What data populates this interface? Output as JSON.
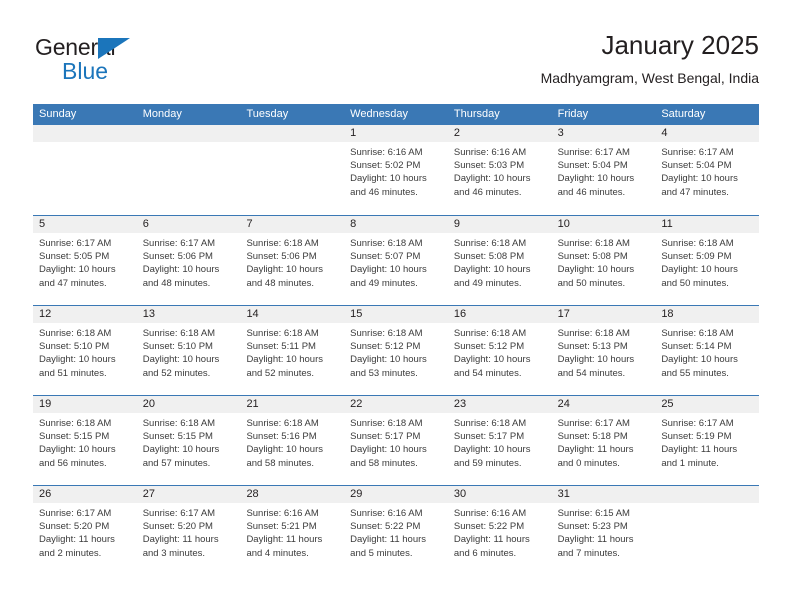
{
  "brand": {
    "word_one": "General",
    "word_two": "Blue",
    "accent_color": "#1b75bb",
    "triangle_icon": "brand-triangle-icon"
  },
  "header": {
    "title": "January 2025",
    "subtitle": "Madhyamgram, West Bengal, India"
  },
  "calendar": {
    "header_bg": "#3a78b5",
    "daynum_bg": "#f0f0f0",
    "weekdays": [
      "Sunday",
      "Monday",
      "Tuesday",
      "Wednesday",
      "Thursday",
      "Friday",
      "Saturday"
    ],
    "weeks": [
      [
        {
          "day": "",
          "empty": true
        },
        {
          "day": "",
          "empty": true
        },
        {
          "day": "",
          "empty": true
        },
        {
          "day": "1",
          "sunrise": "Sunrise: 6:16 AM",
          "sunset": "Sunset: 5:02 PM",
          "daylight": "Daylight: 10 hours and 46 minutes."
        },
        {
          "day": "2",
          "sunrise": "Sunrise: 6:16 AM",
          "sunset": "Sunset: 5:03 PM",
          "daylight": "Daylight: 10 hours and 46 minutes."
        },
        {
          "day": "3",
          "sunrise": "Sunrise: 6:17 AM",
          "sunset": "Sunset: 5:04 PM",
          "daylight": "Daylight: 10 hours and 46 minutes."
        },
        {
          "day": "4",
          "sunrise": "Sunrise: 6:17 AM",
          "sunset": "Sunset: 5:04 PM",
          "daylight": "Daylight: 10 hours and 47 minutes."
        }
      ],
      [
        {
          "day": "5",
          "sunrise": "Sunrise: 6:17 AM",
          "sunset": "Sunset: 5:05 PM",
          "daylight": "Daylight: 10 hours and 47 minutes."
        },
        {
          "day": "6",
          "sunrise": "Sunrise: 6:17 AM",
          "sunset": "Sunset: 5:06 PM",
          "daylight": "Daylight: 10 hours and 48 minutes."
        },
        {
          "day": "7",
          "sunrise": "Sunrise: 6:18 AM",
          "sunset": "Sunset: 5:06 PM",
          "daylight": "Daylight: 10 hours and 48 minutes."
        },
        {
          "day": "8",
          "sunrise": "Sunrise: 6:18 AM",
          "sunset": "Sunset: 5:07 PM",
          "daylight": "Daylight: 10 hours and 49 minutes."
        },
        {
          "day": "9",
          "sunrise": "Sunrise: 6:18 AM",
          "sunset": "Sunset: 5:08 PM",
          "daylight": "Daylight: 10 hours and 49 minutes."
        },
        {
          "day": "10",
          "sunrise": "Sunrise: 6:18 AM",
          "sunset": "Sunset: 5:08 PM",
          "daylight": "Daylight: 10 hours and 50 minutes."
        },
        {
          "day": "11",
          "sunrise": "Sunrise: 6:18 AM",
          "sunset": "Sunset: 5:09 PM",
          "daylight": "Daylight: 10 hours and 50 minutes."
        }
      ],
      [
        {
          "day": "12",
          "sunrise": "Sunrise: 6:18 AM",
          "sunset": "Sunset: 5:10 PM",
          "daylight": "Daylight: 10 hours and 51 minutes."
        },
        {
          "day": "13",
          "sunrise": "Sunrise: 6:18 AM",
          "sunset": "Sunset: 5:10 PM",
          "daylight": "Daylight: 10 hours and 52 minutes."
        },
        {
          "day": "14",
          "sunrise": "Sunrise: 6:18 AM",
          "sunset": "Sunset: 5:11 PM",
          "daylight": "Daylight: 10 hours and 52 minutes."
        },
        {
          "day": "15",
          "sunrise": "Sunrise: 6:18 AM",
          "sunset": "Sunset: 5:12 PM",
          "daylight": "Daylight: 10 hours and 53 minutes."
        },
        {
          "day": "16",
          "sunrise": "Sunrise: 6:18 AM",
          "sunset": "Sunset: 5:12 PM",
          "daylight": "Daylight: 10 hours and 54 minutes."
        },
        {
          "day": "17",
          "sunrise": "Sunrise: 6:18 AM",
          "sunset": "Sunset: 5:13 PM",
          "daylight": "Daylight: 10 hours and 54 minutes."
        },
        {
          "day": "18",
          "sunrise": "Sunrise: 6:18 AM",
          "sunset": "Sunset: 5:14 PM",
          "daylight": "Daylight: 10 hours and 55 minutes."
        }
      ],
      [
        {
          "day": "19",
          "sunrise": "Sunrise: 6:18 AM",
          "sunset": "Sunset: 5:15 PM",
          "daylight": "Daylight: 10 hours and 56 minutes."
        },
        {
          "day": "20",
          "sunrise": "Sunrise: 6:18 AM",
          "sunset": "Sunset: 5:15 PM",
          "daylight": "Daylight: 10 hours and 57 minutes."
        },
        {
          "day": "21",
          "sunrise": "Sunrise: 6:18 AM",
          "sunset": "Sunset: 5:16 PM",
          "daylight": "Daylight: 10 hours and 58 minutes."
        },
        {
          "day": "22",
          "sunrise": "Sunrise: 6:18 AM",
          "sunset": "Sunset: 5:17 PM",
          "daylight": "Daylight: 10 hours and 58 minutes."
        },
        {
          "day": "23",
          "sunrise": "Sunrise: 6:18 AM",
          "sunset": "Sunset: 5:17 PM",
          "daylight": "Daylight: 10 hours and 59 minutes."
        },
        {
          "day": "24",
          "sunrise": "Sunrise: 6:17 AM",
          "sunset": "Sunset: 5:18 PM",
          "daylight": "Daylight: 11 hours and 0 minutes."
        },
        {
          "day": "25",
          "sunrise": "Sunrise: 6:17 AM",
          "sunset": "Sunset: 5:19 PM",
          "daylight": "Daylight: 11 hours and 1 minute."
        }
      ],
      [
        {
          "day": "26",
          "sunrise": "Sunrise: 6:17 AM",
          "sunset": "Sunset: 5:20 PM",
          "daylight": "Daylight: 11 hours and 2 minutes."
        },
        {
          "day": "27",
          "sunrise": "Sunrise: 6:17 AM",
          "sunset": "Sunset: 5:20 PM",
          "daylight": "Daylight: 11 hours and 3 minutes."
        },
        {
          "day": "28",
          "sunrise": "Sunrise: 6:16 AM",
          "sunset": "Sunset: 5:21 PM",
          "daylight": "Daylight: 11 hours and 4 minutes."
        },
        {
          "day": "29",
          "sunrise": "Sunrise: 6:16 AM",
          "sunset": "Sunset: 5:22 PM",
          "daylight": "Daylight: 11 hours and 5 minutes."
        },
        {
          "day": "30",
          "sunrise": "Sunrise: 6:16 AM",
          "sunset": "Sunset: 5:22 PM",
          "daylight": "Daylight: 11 hours and 6 minutes."
        },
        {
          "day": "31",
          "sunrise": "Sunrise: 6:15 AM",
          "sunset": "Sunset: 5:23 PM",
          "daylight": "Daylight: 11 hours and 7 minutes."
        },
        {
          "day": "",
          "empty": true
        }
      ]
    ]
  }
}
